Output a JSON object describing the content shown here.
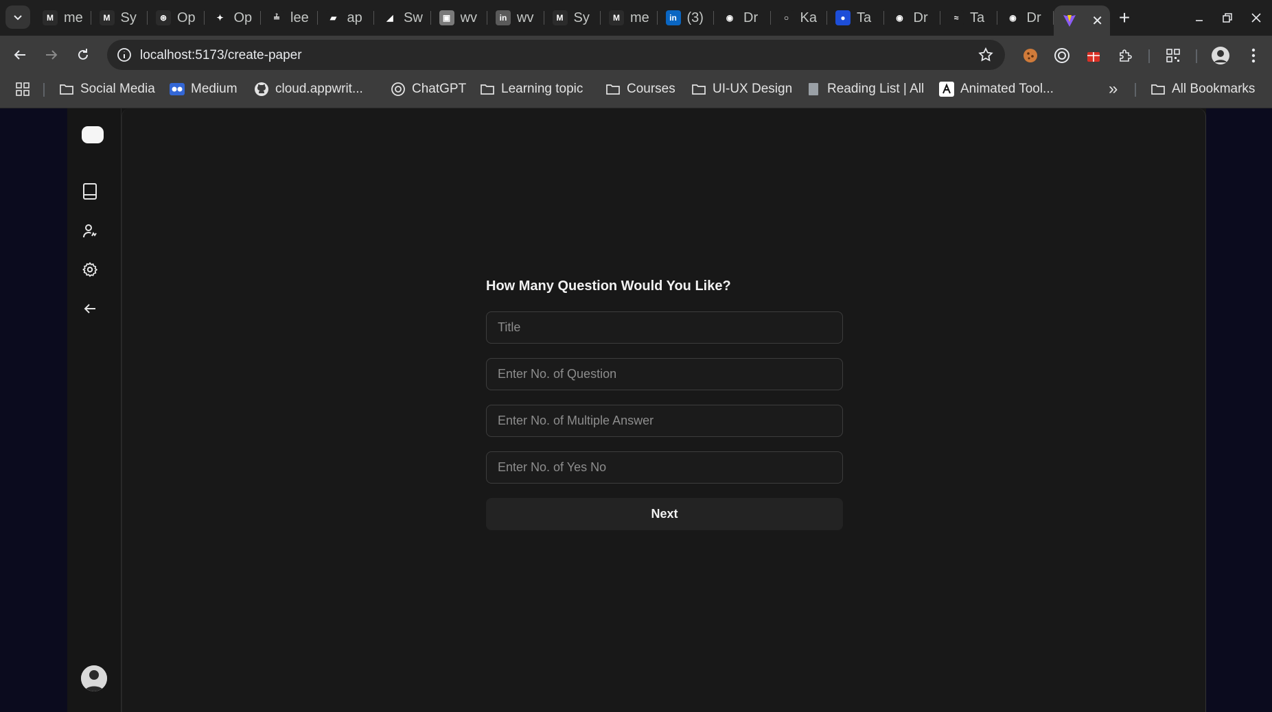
{
  "browser": {
    "tabs": [
      {
        "title": "me",
        "icon": "medium-icon",
        "favicon_bg": "#2b2b2b",
        "favicon_text": "M"
      },
      {
        "title": "Sy",
        "icon": "medium-icon",
        "favicon_bg": "#2b2b2b",
        "favicon_text": "M"
      },
      {
        "title": "Op",
        "icon": "openai-icon",
        "favicon_bg": "#2b2b2b",
        "favicon_text": "⊛"
      },
      {
        "title": "Op",
        "icon": "sparkle-icon",
        "favicon_bg": "#1f1f1f",
        "favicon_text": "✦"
      },
      {
        "title": "lee",
        "icon": "leetcode-icon",
        "favicon_bg": "#1f1f1f",
        "favicon_text": "≟"
      },
      {
        "title": "ap",
        "icon": "appwrite-icon",
        "favicon_bg": "#1f1f1f",
        "favicon_text": "▰"
      },
      {
        "title": "Sw",
        "icon": "swift-icon",
        "favicon_bg": "#1f1f1f",
        "favicon_text": "◢"
      },
      {
        "title": "wv",
        "icon": "webview-icon",
        "favicon_bg": "#7a7a7a",
        "favicon_text": "▣"
      },
      {
        "title": "wv",
        "icon": "linkedin-icon",
        "favicon_bg": "#5a5a5a",
        "favicon_text": "in"
      },
      {
        "title": "Sy",
        "icon": "medium-icon",
        "favicon_bg": "#2b2b2b",
        "favicon_text": "M"
      },
      {
        "title": "me",
        "icon": "medium-icon",
        "favicon_bg": "#2b2b2b",
        "favicon_text": "M"
      },
      {
        "title": "(3)",
        "icon": "linkedin-icon",
        "favicon_bg": "#0a66c2",
        "favicon_text": "in"
      },
      {
        "title": "Dr",
        "icon": "dribbble-icon",
        "favicon_bg": "#1f1f1f",
        "favicon_text": "◉"
      },
      {
        "title": "Ka",
        "icon": "github-icon",
        "favicon_bg": "#1f1f1f",
        "favicon_text": "○"
      },
      {
        "title": "Ta",
        "icon": "tailwind-blue-icon",
        "favicon_bg": "#1d4ed8",
        "favicon_text": "●"
      },
      {
        "title": "Dr",
        "icon": "dribbble-icon",
        "favicon_bg": "#1f1f1f",
        "favicon_text": "◉"
      },
      {
        "title": "Ta",
        "icon": "tailwind-icon",
        "favicon_bg": "#1f1f1f",
        "favicon_text": "≈"
      },
      {
        "title": "Dr",
        "icon": "dribbble-icon",
        "favicon_bg": "#1f1f1f",
        "favicon_text": "◉"
      }
    ],
    "active_tab": {
      "icon": "vite-icon",
      "close": "✕"
    },
    "new_tab": "+",
    "url": "localhost:5173/create-paper",
    "bookmarks": [
      {
        "label": "Social Media",
        "icon": "folder-icon"
      },
      {
        "label": "Medium",
        "icon": "medium-icon"
      },
      {
        "label": "cloud.appwrit...",
        "icon": "github-icon"
      },
      {
        "label": "ChatGPT",
        "icon": "openai-icon"
      },
      {
        "label": "Learning topic",
        "icon": "folder-icon"
      },
      {
        "label": "Courses",
        "icon": "folder-icon"
      },
      {
        "label": "UI-UX Design",
        "icon": "folder-icon"
      },
      {
        "label": "Reading List | All",
        "icon": "reading-list-icon"
      },
      {
        "label": "Animated Tool...",
        "icon": "animated-tool-icon"
      }
    ],
    "overflow": "»",
    "all_bookmarks": "All Bookmarks"
  },
  "sidebar": {
    "items": [
      {
        "icon": "book-icon"
      },
      {
        "icon": "user-add-icon"
      },
      {
        "icon": "settings-icon"
      },
      {
        "icon": "arrow-left-icon"
      }
    ]
  },
  "form": {
    "title": "How Many Question Would You Like?",
    "fields": [
      {
        "placeholder": "Title",
        "value": ""
      },
      {
        "placeholder": "Enter No. of Question",
        "value": ""
      },
      {
        "placeholder": "Enter No. of Multiple Answer",
        "value": ""
      },
      {
        "placeholder": "Enter No. of Yes No",
        "value": ""
      }
    ],
    "submit_label": "Next"
  },
  "colors": {
    "background": "#0b0b1e",
    "panel": "#181818",
    "field_border": "#3d3d3d",
    "button": "#232323"
  }
}
